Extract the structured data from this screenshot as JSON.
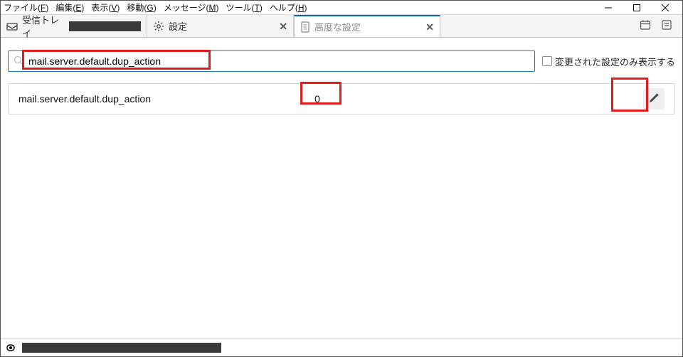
{
  "menu": {
    "file": "ファイル(",
    "file_u": "F",
    "file2": ")",
    "edit": "編集(",
    "edit_u": "E",
    "edit2": ")",
    "view": "表示(",
    "view_u": "V",
    "view2": ")",
    "go": "移動(",
    "go_u": "G",
    "go2": ")",
    "message": "メッセージ(",
    "message_u": "M",
    "message2": ")",
    "tools": "ツール(",
    "tools_u": "T",
    "tools2": ")",
    "help": "ヘルプ(",
    "help_u": "H",
    "help2": ")"
  },
  "tabs": {
    "inbox_label": "受信トレイ",
    "settings_label": "設定",
    "advanced_label": "高度な設定"
  },
  "search": {
    "value": "mail.server.default.dup_action"
  },
  "show_modified_label": "変更された設定のみ表示する",
  "result": {
    "name": "mail.server.default.dup_action",
    "value": "0"
  }
}
